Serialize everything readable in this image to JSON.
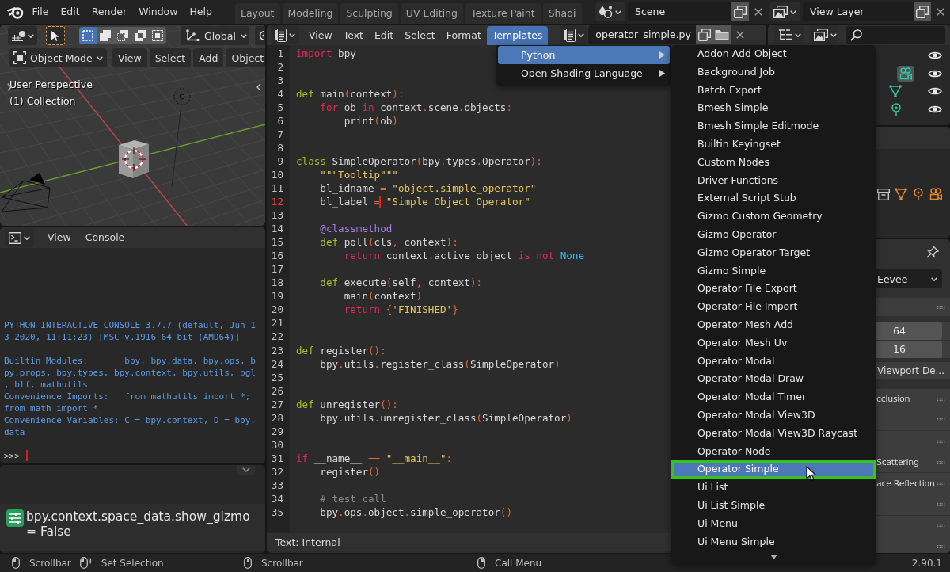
{
  "topbar": {
    "menus": [
      "File",
      "Edit",
      "Render",
      "Window",
      "Help"
    ],
    "workspaces": [
      {
        "label": "Layout",
        "selected": false
      },
      {
        "label": "Modeling",
        "selected": false
      },
      {
        "label": "Sculpting",
        "selected": false
      },
      {
        "label": "UV Editing",
        "selected": false
      },
      {
        "label": "Texture Paint",
        "selected": false
      },
      {
        "label": "Shadi",
        "selected": false
      }
    ],
    "scene": "Scene",
    "view_layer": "View Layer"
  },
  "viewport": {
    "select_modes": [
      {
        "kind": "set",
        "selected": true
      },
      {
        "kind": "extend",
        "selected": false
      },
      {
        "kind": "subtract",
        "selected": false
      },
      {
        "kind": "difference",
        "selected": false
      },
      {
        "kind": "intersect",
        "selected": false
      }
    ],
    "orientation": "Global",
    "mode": "Object Mode",
    "menus": [
      "View",
      "Select",
      "Add",
      "Object"
    ],
    "overlay": [
      "User Perspective",
      "(1) Collection"
    ]
  },
  "console": {
    "menus": [
      "View",
      "Console"
    ],
    "blocks": [
      [
        "PYTHON INTERACTIVE CONSOLE 3.7.7 (default, Jun 1",
        "3 2020, 11:11:23) [MSC v.1916 64 bit (AMD64)]"
      ],
      [
        "Builtin Modules:       bpy, bpy.data, bpy.ops, b",
        "py.props, bpy.types, bpy.context, bpy.utils, bgl",
        ", blf, mathutils",
        "Convenience Imports:   from mathutils import *;",
        "from math import *",
        "Convenience Variables: C = bpy.context, D = bpy.",
        "data"
      ]
    ],
    "prompt": ">>>"
  },
  "info": {
    "entries": [
      {
        "text": "bpy.context.space_data.show_gizmo = False"
      }
    ]
  },
  "text_editor": {
    "menus": [
      {
        "label": "View",
        "selected": false
      },
      {
        "label": "Text",
        "selected": false
      },
      {
        "label": "Edit",
        "selected": false
      },
      {
        "label": "Select",
        "selected": false
      },
      {
        "label": "Format",
        "selected": false
      },
      {
        "label": "Templates",
        "selected": true
      }
    ],
    "file": "operator_simple.py",
    "lines": [
      {
        "number": "1",
        "current": false,
        "tokens": [
          {
            "kind": "keyword",
            "text": "import"
          },
          {
            "kind": "plain",
            "text": " bpy"
          }
        ]
      },
      {
        "number": "2",
        "current": false
      },
      {
        "number": "3",
        "current": false
      },
      {
        "number": "4",
        "current": false,
        "tokens": [
          {
            "kind": "special",
            "text": "def"
          },
          {
            "kind": "plain",
            "text": " main"
          },
          {
            "kind": "operator",
            "text": "("
          },
          {
            "kind": "plain",
            "text": "context"
          },
          {
            "kind": "operator",
            "text": "):"
          }
        ]
      },
      {
        "number": "5",
        "current": false,
        "tokens": [
          {
            "kind": "keyword",
            "text": "    for"
          },
          {
            "kind": "plain",
            "text": " ob "
          },
          {
            "kind": "keyword",
            "text": "in"
          },
          {
            "kind": "plain",
            "text": " context"
          },
          {
            "kind": "operator",
            "text": "."
          },
          {
            "kind": "plain",
            "text": "scene"
          },
          {
            "kind": "operator",
            "text": "."
          },
          {
            "kind": "plain",
            "text": "objects"
          },
          {
            "kind": "operator",
            "text": ":"
          }
        ]
      },
      {
        "number": "6",
        "current": false,
        "tokens": [
          {
            "kind": "plain",
            "text": "        print"
          },
          {
            "kind": "operator",
            "text": "("
          },
          {
            "kind": "plain",
            "text": "ob"
          },
          {
            "kind": "operator",
            "text": ")"
          }
        ]
      },
      {
        "number": "7",
        "current": false
      },
      {
        "number": "8",
        "current": false
      },
      {
        "number": "9",
        "current": false,
        "tokens": [
          {
            "kind": "special",
            "text": "class"
          },
          {
            "kind": "plain",
            "text": " SimpleOperator"
          },
          {
            "kind": "operator",
            "text": "("
          },
          {
            "kind": "plain",
            "text": "bpy"
          },
          {
            "kind": "operator",
            "text": "."
          },
          {
            "kind": "plain",
            "text": "types"
          },
          {
            "kind": "operator",
            "text": "."
          },
          {
            "kind": "plain",
            "text": "Operator"
          },
          {
            "kind": "operator",
            "text": "):"
          }
        ]
      },
      {
        "number": "10",
        "current": false,
        "tokens": [
          {
            "kind": "string",
            "text": "    \"\"\"Tooltip\"\"\""
          }
        ]
      },
      {
        "number": "11",
        "current": false,
        "tokens": [
          {
            "kind": "plain",
            "text": "    bl_idname "
          },
          {
            "kind": "operator",
            "text": "="
          },
          {
            "kind": "string",
            "text": " \"object.simple_operator\""
          }
        ]
      },
      {
        "number": "12",
        "current": true,
        "tokens": [
          {
            "kind": "plain",
            "text": "    bl_label "
          },
          {
            "kind": "operator",
            "text": "="
          },
          {
            "kind": "cursor"
          },
          {
            "kind": "string",
            "text": " \"Simple Object Operator\""
          }
        ]
      },
      {
        "number": "13",
        "current": false
      },
      {
        "number": "14",
        "current": false,
        "tokens": [
          {
            "kind": "decorator",
            "text": "    @classmethod"
          }
        ]
      },
      {
        "number": "15",
        "current": false,
        "tokens": [
          {
            "kind": "special",
            "text": "    def"
          },
          {
            "kind": "plain",
            "text": " poll"
          },
          {
            "kind": "operator",
            "text": "("
          },
          {
            "kind": "plain",
            "text": "cls"
          },
          {
            "kind": "operator",
            "text": ","
          },
          {
            "kind": "plain",
            "text": " context"
          },
          {
            "kind": "operator",
            "text": "):"
          }
        ]
      },
      {
        "number": "16",
        "current": false,
        "tokens": [
          {
            "kind": "keyword",
            "text": "        return"
          },
          {
            "kind": "plain",
            "text": " context"
          },
          {
            "kind": "operator",
            "text": "."
          },
          {
            "kind": "plain",
            "text": "active_object "
          },
          {
            "kind": "keyword",
            "text": "is not"
          },
          {
            "kind": "builtin",
            "text": " None"
          }
        ]
      },
      {
        "number": "17",
        "current": false
      },
      {
        "number": "18",
        "current": false,
        "tokens": [
          {
            "kind": "special",
            "text": "    def"
          },
          {
            "kind": "plain",
            "text": " execute"
          },
          {
            "kind": "operator",
            "text": "("
          },
          {
            "kind": "plain",
            "text": "self"
          },
          {
            "kind": "operator",
            "text": ","
          },
          {
            "kind": "plain",
            "text": " context"
          },
          {
            "kind": "operator",
            "text": "):"
          }
        ]
      },
      {
        "number": "19",
        "current": false,
        "tokens": [
          {
            "kind": "plain",
            "text": "        main"
          },
          {
            "kind": "operator",
            "text": "("
          },
          {
            "kind": "plain",
            "text": "context"
          },
          {
            "kind": "operator",
            "text": ")"
          }
        ]
      },
      {
        "number": "20",
        "current": false,
        "tokens": [
          {
            "kind": "keyword",
            "text": "        return"
          },
          {
            "kind": "operator",
            "text": " {"
          },
          {
            "kind": "string",
            "text": "'FINISHED'"
          },
          {
            "kind": "operator",
            "text": "}"
          }
        ]
      },
      {
        "number": "21",
        "current": false
      },
      {
        "number": "22",
        "current": false
      },
      {
        "number": "23",
        "current": false,
        "tokens": [
          {
            "kind": "special",
            "text": "def"
          },
          {
            "kind": "plain",
            "text": " register"
          },
          {
            "kind": "operator",
            "text": "():"
          }
        ]
      },
      {
        "number": "24",
        "current": false,
        "tokens": [
          {
            "kind": "plain",
            "text": "    bpy"
          },
          {
            "kind": "operator",
            "text": "."
          },
          {
            "kind": "plain",
            "text": "utils"
          },
          {
            "kind": "operator",
            "text": "."
          },
          {
            "kind": "plain",
            "text": "register_class"
          },
          {
            "kind": "operator",
            "text": "("
          },
          {
            "kind": "plain",
            "text": "SimpleOperator"
          },
          {
            "kind": "operator",
            "text": ")"
          }
        ]
      },
      {
        "number": "25",
        "current": false
      },
      {
        "number": "26",
        "current": false
      },
      {
        "number": "27",
        "current": false,
        "tokens": [
          {
            "kind": "special",
            "text": "def"
          },
          {
            "kind": "plain",
            "text": " unregister"
          },
          {
            "kind": "operator",
            "text": "():"
          }
        ]
      },
      {
        "number": "28",
        "current": false,
        "tokens": [
          {
            "kind": "plain",
            "text": "    bpy"
          },
          {
            "kind": "operator",
            "text": "."
          },
          {
            "kind": "plain",
            "text": "utils"
          },
          {
            "kind": "operator",
            "text": "."
          },
          {
            "kind": "plain",
            "text": "unregister_class"
          },
          {
            "kind": "operator",
            "text": "("
          },
          {
            "kind": "plain",
            "text": "SimpleOperator"
          },
          {
            "kind": "operator",
            "text": ")"
          }
        ]
      },
      {
        "number": "29",
        "current": false
      },
      {
        "number": "30",
        "current": false
      },
      {
        "number": "31",
        "current": false,
        "tokens": [
          {
            "kind": "keyword",
            "text": "if"
          },
          {
            "kind": "plain",
            "text": " __name__ "
          },
          {
            "kind": "operator",
            "text": "=="
          },
          {
            "kind": "string",
            "text": " \"__main__\""
          },
          {
            "kind": "operator",
            "text": ":"
          }
        ]
      },
      {
        "number": "32",
        "current": false,
        "tokens": [
          {
            "kind": "plain",
            "text": "    register"
          },
          {
            "kind": "operator",
            "text": "()"
          }
        ]
      },
      {
        "number": "33",
        "current": false
      },
      {
        "number": "34",
        "current": false,
        "tokens": [
          {
            "kind": "comment",
            "text": "    # test call"
          }
        ]
      },
      {
        "number": "35",
        "current": false,
        "tokens": [
          {
            "kind": "plain",
            "text": "    bpy"
          },
          {
            "kind": "operator",
            "text": "."
          },
          {
            "kind": "plain",
            "text": "ops"
          },
          {
            "kind": "operator",
            "text": "."
          },
          {
            "kind": "plain",
            "text": "object"
          },
          {
            "kind": "operator",
            "text": "."
          },
          {
            "kind": "plain",
            "text": "simple_operator"
          },
          {
            "kind": "operator",
            "text": "()"
          }
        ]
      }
    ],
    "footer": "Text: Internal"
  },
  "templates_menu": {
    "items": [
      {
        "label": "Python",
        "selected": true
      },
      {
        "label": "Open Shading Language",
        "selected": false
      }
    ]
  },
  "python_templates": {
    "items": [
      {
        "label": "Addon Add Object",
        "selected": false
      },
      {
        "label": "Background Job",
        "selected": false
      },
      {
        "label": "Batch Export",
        "selected": false
      },
      {
        "label": "Bmesh Simple",
        "selected": false
      },
      {
        "label": "Bmesh Simple Editmode",
        "selected": false
      },
      {
        "label": "Builtin Keyingset",
        "selected": false
      },
      {
        "label": "Custom Nodes",
        "selected": false
      },
      {
        "label": "Driver Functions",
        "selected": false
      },
      {
        "label": "External Script Stub",
        "selected": false
      },
      {
        "label": "Gizmo Custom Geometry",
        "selected": false
      },
      {
        "label": "Gizmo Operator",
        "selected": false
      },
      {
        "label": "Gizmo Operator Target",
        "selected": false
      },
      {
        "label": "Gizmo Simple",
        "selected": false
      },
      {
        "label": "Operator File Export",
        "selected": false
      },
      {
        "label": "Operator File Import",
        "selected": false
      },
      {
        "label": "Operator Mesh Add",
        "selected": false
      },
      {
        "label": "Operator Mesh Uv",
        "selected": false
      },
      {
        "label": "Operator Modal",
        "selected": false
      },
      {
        "label": "Operator Modal Draw",
        "selected": false
      },
      {
        "label": "Operator Modal Timer",
        "selected": false
      },
      {
        "label": "Operator Modal View3D",
        "selected": false
      },
      {
        "label": "Operator Modal View3D Raycast",
        "selected": false
      },
      {
        "label": "Operator Node",
        "selected": false
      },
      {
        "label": "Operator Simple",
        "selected": true
      },
      {
        "label": "Ui List",
        "selected": false
      },
      {
        "label": "Ui List Simple",
        "selected": false
      },
      {
        "label": "Ui Menu",
        "selected": false
      },
      {
        "label": "Ui Menu Simple",
        "selected": false
      }
    ]
  },
  "outliner": {
    "rows": [
      {
        "kind": "collection"
      },
      {
        "kind": "camera",
        "active": true
      },
      {
        "kind": "mesh",
        "active": false
      },
      {
        "kind": "light",
        "active": false
      }
    ]
  },
  "blend_file": {
    "icons": [
      {
        "kind": "archive"
      },
      {
        "kind": "mesh"
      },
      {
        "kind": "light"
      },
      {
        "kind": "camera"
      }
    ]
  },
  "properties": {
    "rows": [
      {
        "kind": "pin"
      },
      {
        "kind": "dropdown",
        "value": "Eevee"
      },
      {
        "kind": "panel"
      },
      {
        "kind": "number",
        "value": "64"
      },
      {
        "kind": "number",
        "value": "16"
      },
      {
        "kind": "check",
        "label": "Viewport De..."
      },
      {
        "kind": "panel",
        "label": "cclusion"
      },
      {
        "kind": "panel"
      },
      {
        "kind": "panel"
      },
      {
        "kind": "panel",
        "label": "Scattering"
      },
      {
        "kind": "panel",
        "label": "ace Reflection"
      },
      {
        "kind": "panel"
      },
      {
        "kind": "panel"
      },
      {
        "kind": "panel"
      }
    ]
  },
  "status_bar": {
    "groups": [
      {
        "hints": [
          {
            "kind": "lmb",
            "label": "Scrollbar"
          },
          {
            "kind": "lmb_drag",
            "label": "Set Selection"
          }
        ]
      },
      {
        "hints": [
          {
            "kind": "mmb",
            "label": "Scrollbar"
          }
        ]
      },
      {
        "hints": [
          {
            "kind": "rmb",
            "label": "Call Menu"
          }
        ]
      }
    ],
    "version": "2.90.1"
  }
}
